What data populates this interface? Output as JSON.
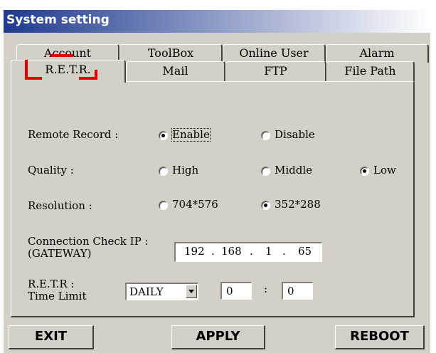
{
  "window": {
    "title": "System setting"
  },
  "tabs": {
    "back_row": [
      "Account",
      "ToolBox",
      "Online User",
      "Alarm"
    ],
    "front_row": [
      "R.E.T.R.",
      "Mail",
      "FTP",
      "File Path"
    ],
    "active": "R.E.T.R."
  },
  "retr": {
    "remote_record": {
      "label": "Remote Record :",
      "options": [
        "Enable",
        "Disable"
      ],
      "selected": "Enable"
    },
    "quality": {
      "label": "Quality :",
      "options": [
        "High",
        "Middle",
        "Low"
      ],
      "selected": "Low"
    },
    "resolution": {
      "label": "Resolution :",
      "options": [
        "704*576",
        "352*288"
      ],
      "selected": "352*288"
    },
    "connection_check": {
      "label_line1": "Connection Check IP :",
      "label_line2": "(GATEWAY)",
      "ip": [
        "192",
        "168",
        "1",
        "65"
      ]
    },
    "time_limit": {
      "label_line1": "R.E.T.R :",
      "label_line2": "Time Limit",
      "period": "DAILY",
      "hour": "0",
      "separator": ":",
      "minute": "0"
    }
  },
  "buttons": {
    "exit": "EXIT",
    "apply": "APPLY",
    "reboot": "REBOOT"
  },
  "colors": {
    "title_bar_start": "#1f3a8f",
    "dialog_bg": "#d4d0c8",
    "highlight": "#e00000"
  }
}
